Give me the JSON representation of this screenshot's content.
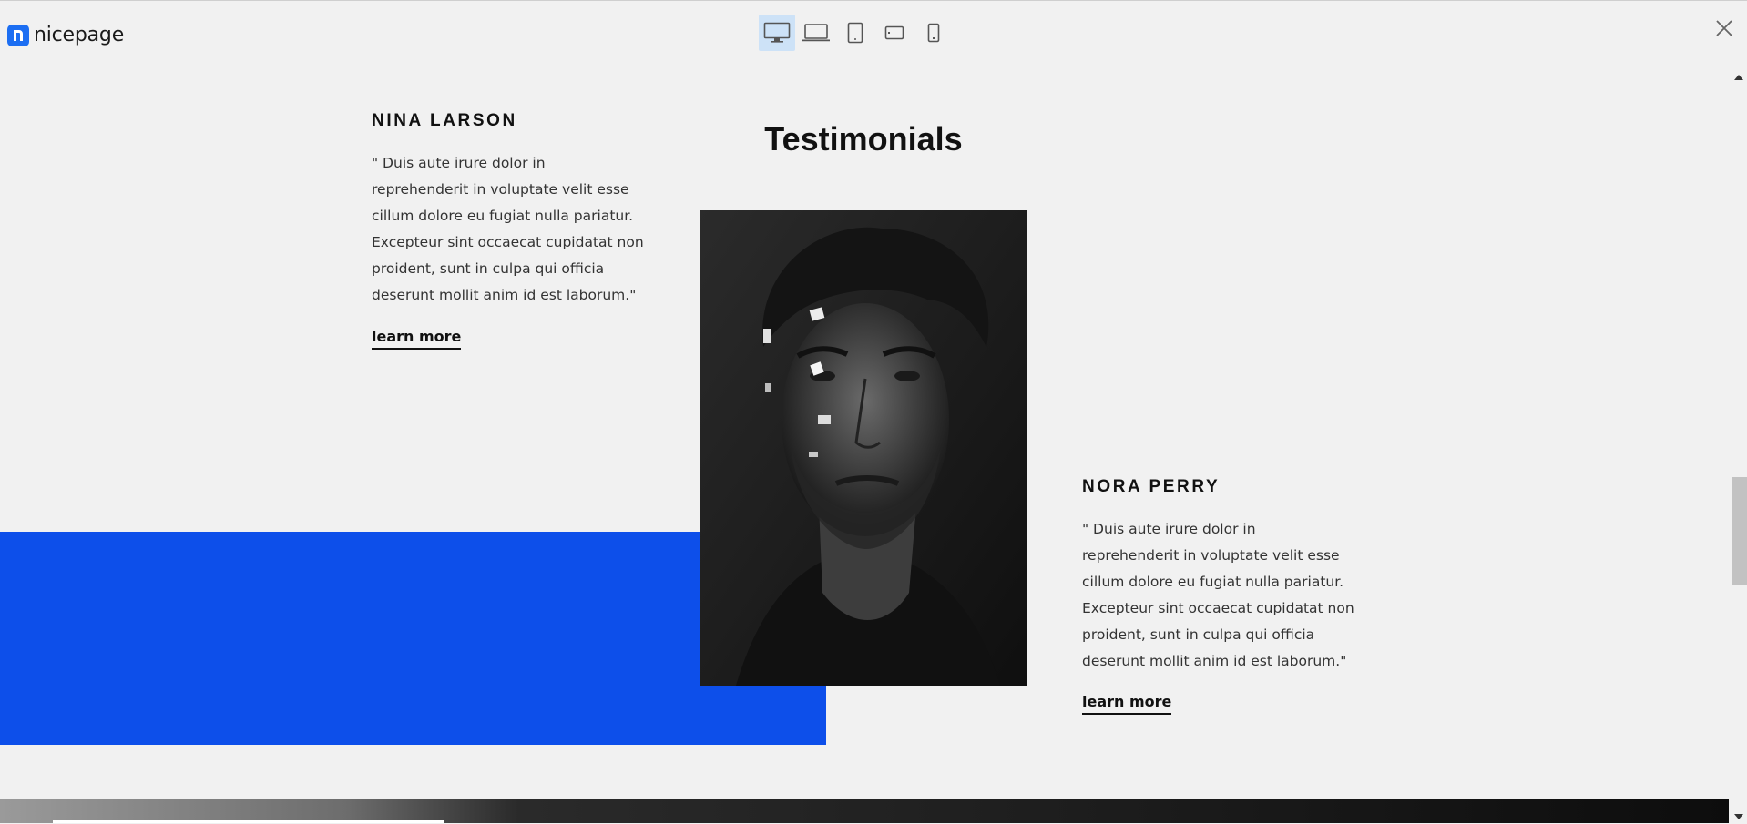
{
  "app": {
    "brand": "nicepage",
    "devices": [
      {
        "icon": "desktop-icon",
        "active": true
      },
      {
        "icon": "laptop-icon",
        "active": false
      },
      {
        "icon": "tablet-icon",
        "active": false
      },
      {
        "icon": "phone-landscape-icon",
        "active": false
      },
      {
        "icon": "phone-portrait-icon",
        "active": false
      }
    ],
    "close_icon": "close-icon"
  },
  "section": {
    "title": "Testimonials",
    "accent_color": "#0d4fea"
  },
  "testimonials": [
    {
      "name": "NINA LARSON",
      "quote": "\" Duis aute irure dolor in reprehenderit in voluptate velit esse cillum dolore eu fugiat nulla pariatur. Excepteur sint occaecat cupidatat non proident, sunt in culpa qui officia deserunt mollit anim id est laborum.\"",
      "link": "learn more"
    },
    {
      "name": "NORA PERRY",
      "quote": "\" Duis aute irure dolor in reprehenderit in voluptate velit esse cillum dolore eu fugiat nulla pariatur. Excepteur sint occaecat cupidatat non proident, sunt in culpa qui officia deserunt mollit anim id est laborum.\"",
      "link": "learn more"
    }
  ]
}
